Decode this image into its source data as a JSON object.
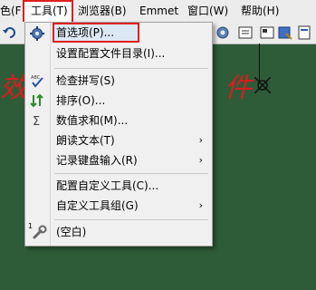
{
  "menubar": {
    "items": [
      {
        "label": "色(F)"
      },
      {
        "label": "工具(T)"
      },
      {
        "label": "浏览器(B)"
      },
      {
        "label": "Emmet"
      },
      {
        "label": "窗口(W)"
      },
      {
        "label": "帮助(H)"
      }
    ]
  },
  "editor": {
    "text_left": "效",
    "text_right": "件"
  },
  "tools_menu": {
    "items": [
      {
        "label": "首选项(P)...",
        "icon": "gear-icon"
      },
      {
        "label": "设置配置文件目录(I)..."
      },
      {
        "label": "检查拼写(S)",
        "icon": "spellcheck-icon"
      },
      {
        "label": "排序(O)...",
        "icon": "sort-icon"
      },
      {
        "label": "数值求和(M)...",
        "icon": "sigma-icon"
      },
      {
        "label": "朗读文本(T)",
        "submenu": true
      },
      {
        "label": "记录键盘输入(R)",
        "submenu": true
      },
      {
        "label": "配置自定义工具(C)..."
      },
      {
        "label": "自定义工具组(G)",
        "submenu": true
      },
      {
        "label": "(空白)",
        "icon": "wrench-icon",
        "prefix": "1"
      }
    ],
    "submenu_arrow": "›"
  },
  "colors": {
    "highlight_border": "#e01e1e",
    "editor_bg": "#2e5c38",
    "menu_bg": "#f0f0f0"
  }
}
